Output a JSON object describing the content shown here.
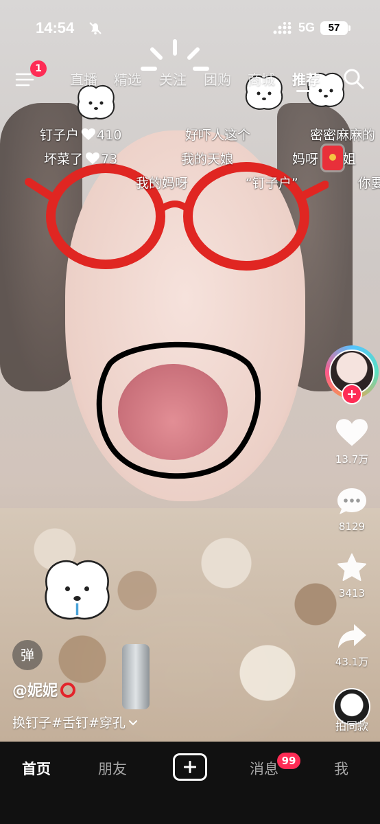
{
  "status_bar": {
    "time": "14:54",
    "network": "5G",
    "battery": "57"
  },
  "top_nav": {
    "menu_badge": "1",
    "tabs": [
      {
        "label": "直播",
        "active": false
      },
      {
        "label": "精选",
        "active": false
      },
      {
        "label": "关注",
        "active": false
      },
      {
        "label": "团购",
        "active": false
      },
      {
        "label": "商城",
        "active": false
      },
      {
        "label": "推荐",
        "active": true
      }
    ]
  },
  "danmaku": [
    {
      "text": "钉子户",
      "likes": "410"
    },
    {
      "text": "好吓人这个"
    },
    {
      "text": "密密麻麻的"
    },
    {
      "text": "坏菜了",
      "likes": "73"
    },
    {
      "text": "我的天娘"
    },
    {
      "text": "妈呀"
    },
    {
      "text": "姐"
    },
    {
      "text": "我的妈呀"
    },
    {
      "text": "“钉子户”"
    },
    {
      "text": "你要"
    }
  ],
  "actions": {
    "like_count": "13.7万",
    "comment_count": "8129",
    "favorite_count": "3413",
    "share_count": "43.1万",
    "same_shot_label": "拍同款"
  },
  "video_info": {
    "danmu_toggle": "弹",
    "author": "@妮妮",
    "caption": "换钉子#舌钉#穿孔"
  },
  "bottom_nav": {
    "items": [
      {
        "label": "首页",
        "active": true
      },
      {
        "label": "朋友",
        "active": false
      },
      {
        "label": "消息",
        "active": false
      },
      {
        "label": "我",
        "active": false
      }
    ],
    "message_badge": "99"
  },
  "colors": {
    "accent": "#fe2c55",
    "bar_bg": "#111111"
  }
}
